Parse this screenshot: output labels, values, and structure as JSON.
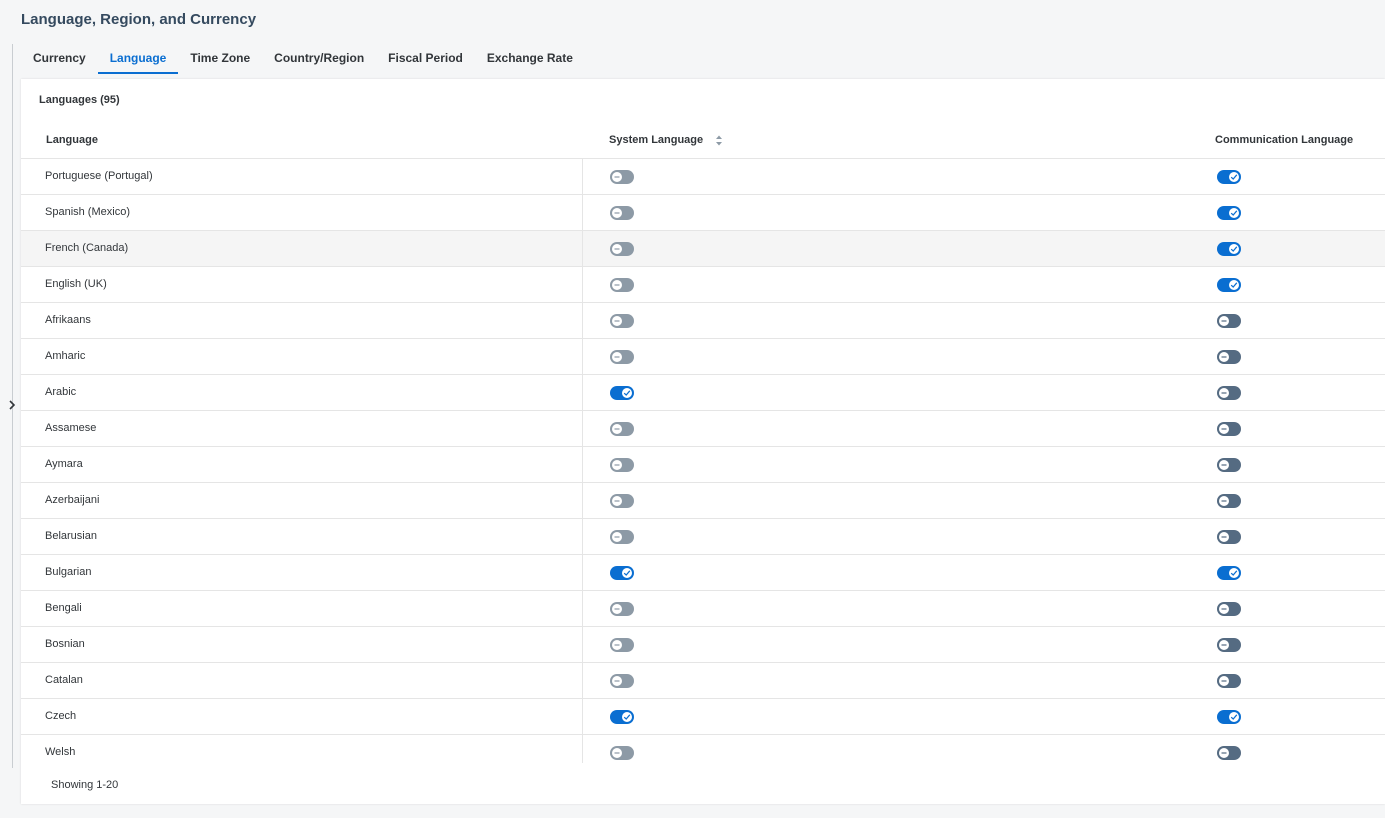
{
  "page": {
    "title": "Language, Region, and Currency"
  },
  "tabs": [
    {
      "label": "Currency",
      "active": false
    },
    {
      "label": "Language",
      "active": true
    },
    {
      "label": "Time Zone",
      "active": false
    },
    {
      "label": "Country/Region",
      "active": false
    },
    {
      "label": "Fiscal Period",
      "active": false
    },
    {
      "label": "Exchange Rate",
      "active": false
    }
  ],
  "languages_table": {
    "title": "Languages (95)",
    "columns": {
      "language": "Language",
      "system_language": "System Language",
      "communication_language": "Communication Language"
    },
    "rows": [
      {
        "language": "Portuguese (Portugal)",
        "system": false,
        "communication": true
      },
      {
        "language": "Spanish (Mexico)",
        "system": false,
        "communication": true
      },
      {
        "language": "French (Canada)",
        "system": false,
        "communication": true
      },
      {
        "language": "English (UK)",
        "system": false,
        "communication": true
      },
      {
        "language": "Afrikaans",
        "system": false,
        "communication": false
      },
      {
        "language": "Amharic",
        "system": false,
        "communication": false
      },
      {
        "language": "Arabic",
        "system": true,
        "communication": false
      },
      {
        "language": "Assamese",
        "system": false,
        "communication": false
      },
      {
        "language": "Aymara",
        "system": false,
        "communication": false
      },
      {
        "language": "Azerbaijani",
        "system": false,
        "communication": false
      },
      {
        "language": "Belarusian",
        "system": false,
        "communication": false
      },
      {
        "language": "Bulgarian",
        "system": true,
        "communication": true
      },
      {
        "language": "Bengali",
        "system": false,
        "communication": false
      },
      {
        "language": "Bosnian",
        "system": false,
        "communication": false
      },
      {
        "language": "Catalan",
        "system": false,
        "communication": false
      },
      {
        "language": "Czech",
        "system": true,
        "communication": true
      },
      {
        "language": "Welsh",
        "system": false,
        "communication": false
      }
    ],
    "footer": "Showing 1-20"
  },
  "colors": {
    "accent": "#0a6ed1",
    "switch_off_system": "#8d9aa6",
    "switch_off_communication": "#556b82"
  },
  "icons": {
    "expand": "chevron-right-icon",
    "sort": "sort-icon",
    "switch_on": "checkmark-icon",
    "switch_off": "minus-icon"
  }
}
